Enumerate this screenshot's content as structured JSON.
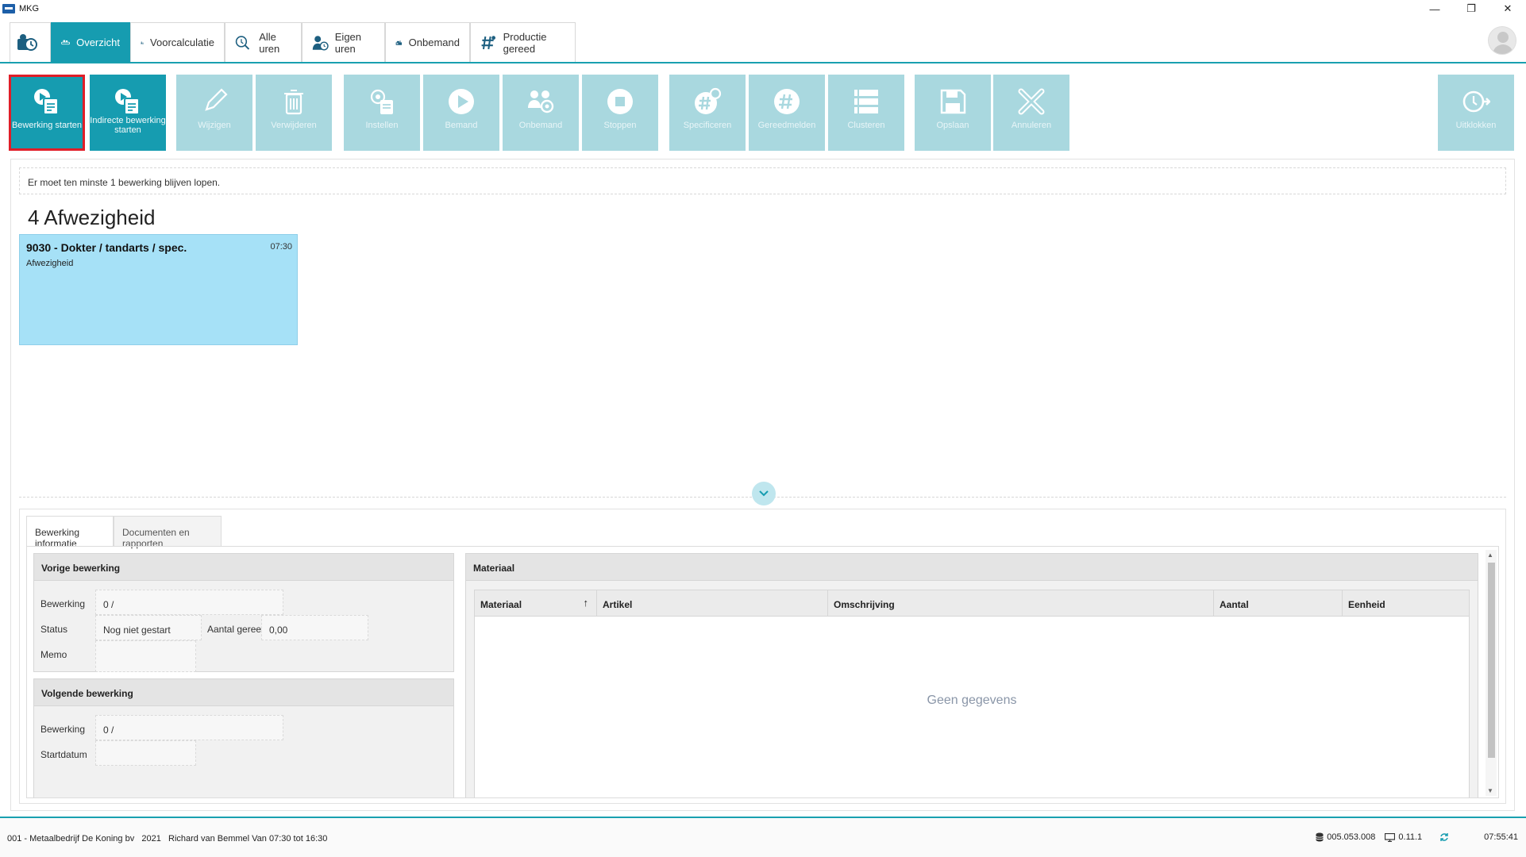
{
  "window": {
    "title": "MKG",
    "controls": {
      "minimize": "—",
      "restore": "❐",
      "close": "✕"
    }
  },
  "nav": {
    "tabs": [
      {
        "label": "",
        "icon": "clock-badge-icon"
      },
      {
        "label": "Overzicht",
        "icon": "conveyor-icon"
      },
      {
        "label": "Voorcalculatie",
        "icon": "calc-person-icon"
      },
      {
        "label": "Alle uren",
        "icon": "search-clock-icon"
      },
      {
        "label": "Eigen uren",
        "icon": "person-clock-icon"
      },
      {
        "label": "Onbemand",
        "icon": "machine-icon"
      },
      {
        "label": "Productie gereed",
        "icon": "hash-person-icon"
      }
    ]
  },
  "toolbar": {
    "buttons": [
      {
        "label": "Bewerking starten",
        "icon": "play-document-icon"
      },
      {
        "label": "Indirecte bewerking starten",
        "icon": "play-document-icon"
      },
      {
        "label": "Wijzigen",
        "icon": "pencil-icon"
      },
      {
        "label": "Verwijderen",
        "icon": "trash-icon"
      },
      {
        "label": "Instellen",
        "icon": "settings-document-icon"
      },
      {
        "label": "Bemand",
        "icon": "play-circle-icon"
      },
      {
        "label": "Onbemand",
        "icon": "people-gear-icon"
      },
      {
        "label": "Stoppen",
        "icon": "stop-circle-icon"
      },
      {
        "label": "Specificeren",
        "icon": "hash-gear-icon"
      },
      {
        "label": "Gereedmelden",
        "icon": "hash-circle-icon"
      },
      {
        "label": "Clusteren",
        "icon": "cluster-icon"
      },
      {
        "label": "Opslaan",
        "icon": "save-icon"
      },
      {
        "label": "Annuleren",
        "icon": "cancel-x-icon"
      },
      {
        "label": "Uitklokken",
        "icon": "clock-out-icon"
      }
    ]
  },
  "notice": "Er moet ten minste 1 bewerking blijven lopen.",
  "group": {
    "title": "4 Afwezigheid",
    "card": {
      "title": "9030 - Dokter / tandarts / spec.",
      "subtitle": "Afwezigheid",
      "time": "07:30"
    }
  },
  "details": {
    "tabs": [
      "Bewerking informatie",
      "Documenten en rapporten"
    ],
    "vorige": {
      "title": "Vorige bewerking",
      "bewerking_label": "Bewerking",
      "bewerking_value": "0 /",
      "status_label": "Status",
      "status_value": "Nog niet gestart",
      "aantal_label": "Aantal gereed",
      "aantal_value": "0,00",
      "memo_label": "Memo",
      "memo_value": ""
    },
    "volgende": {
      "title": "Volgende bewerking",
      "bewerking_label": "Bewerking",
      "bewerking_value": "0 /",
      "startdatum_label": "Startdatum"
    },
    "materiaal": {
      "title": "Materiaal",
      "columns": [
        "Materiaal",
        "Artikel",
        "Omschrijving",
        "Aantal",
        "Eenheid"
      ],
      "sort_indicator": "↑",
      "empty": "Geen gegevens"
    }
  },
  "statusbar": {
    "left": "001 - Metaalbedrijf De Koning bv   2021   Richard van Bemmel Van 07:30 tot 16:30",
    "db_version": "005.053.008",
    "client_version": "0.11.1",
    "clock": "07:55:41"
  },
  "colors": {
    "accent": "#169cb0",
    "disabled_button": "#a9d8df",
    "card": "#a6e1f7",
    "selected_outline": "#e01e28"
  }
}
